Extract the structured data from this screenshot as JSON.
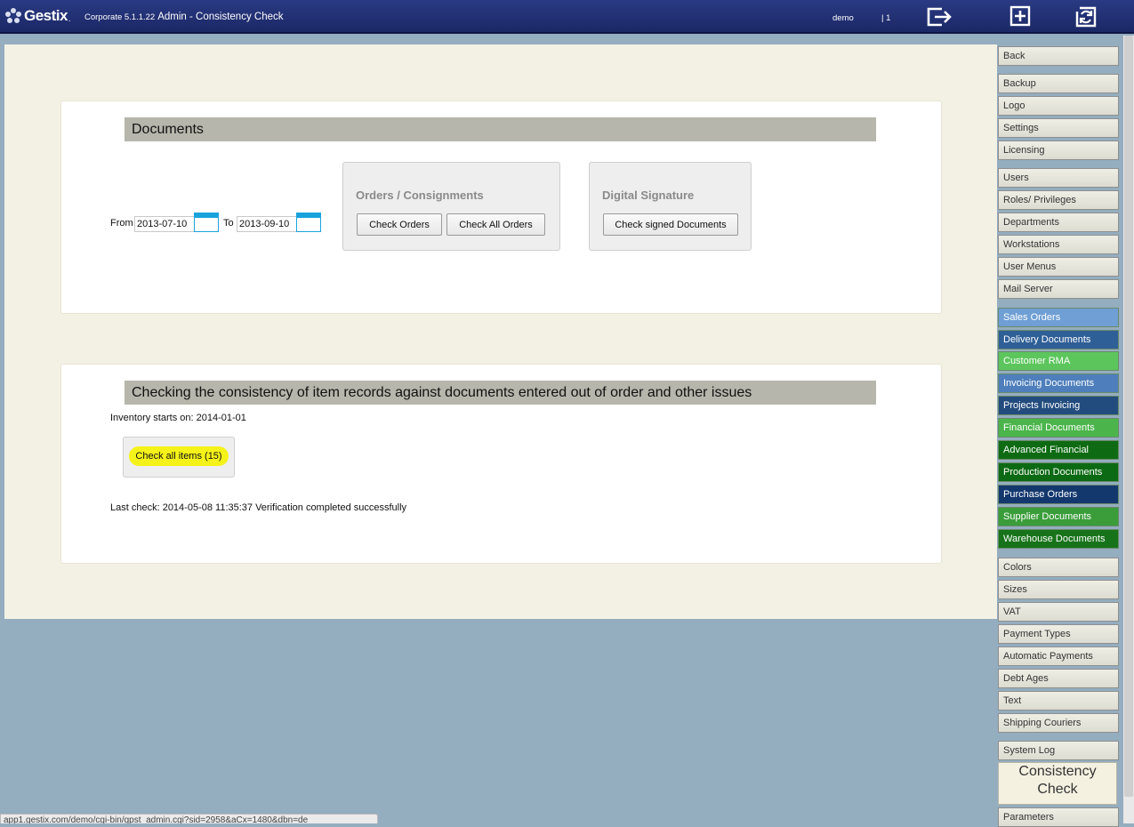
{
  "header": {
    "logo_text": "Gestix",
    "logo_dot": ".",
    "version": "Corporate 5.1.1.22",
    "title": "Admin - Consistency Check",
    "user": "demo",
    "user_count": "| 1",
    "icons": [
      "logout-icon",
      "add-window-icon",
      "refresh-window-icon"
    ]
  },
  "documents": {
    "heading": "Documents",
    "from_label": "From",
    "from_value": "2013-07-10",
    "to_label": "To",
    "to_value": "2013-09-10",
    "orders": {
      "title": "Orders / Consignments",
      "check_orders": "Check Orders",
      "check_all_orders": "Check All Orders"
    },
    "signature": {
      "title": "Digital Signature",
      "check_signed": "Check signed Documents"
    }
  },
  "items": {
    "heading": "Checking the consistency of item records against documents entered out of order and other issues",
    "inventory_start": "Inventory starts on: 2014-01-01",
    "check_all_items": "Check all items (15)",
    "last_check": "Last check: 2014-05-08 11:35:37 Verification completed successfully"
  },
  "nav": [
    {
      "label": "Back",
      "bg": ""
    },
    {
      "label": "Backup",
      "bg": ""
    },
    {
      "label": "Logo",
      "bg": ""
    },
    {
      "label": "Settings",
      "bg": ""
    },
    {
      "label": "Licensing",
      "bg": ""
    },
    {
      "label": "Users",
      "bg": ""
    },
    {
      "label": "Roles/ Privileges",
      "bg": ""
    },
    {
      "label": "Departments",
      "bg": ""
    },
    {
      "label": "Workstations",
      "bg": ""
    },
    {
      "label": "User Menus",
      "bg": ""
    },
    {
      "label": "Mail Server",
      "bg": ""
    },
    {
      "label": "Sales Orders",
      "bg": "#6f9fd4"
    },
    {
      "label": "Delivery Documents",
      "bg": "#2f5f97"
    },
    {
      "label": "Customer RMA",
      "bg": "#5cc65c"
    },
    {
      "label": "Invoicing Documents",
      "bg": "#4e7fbc"
    },
    {
      "label": "Projects Invoicing",
      "bg": "#234c7e"
    },
    {
      "label": "Financial Documents",
      "bg": "#4bb54b"
    },
    {
      "label": "Advanced Financial",
      "bg": "#0e6b13"
    },
    {
      "label": "Production Documents",
      "bg": "#0d6a14"
    },
    {
      "label": "Purchase Orders",
      "bg": "#13386e"
    },
    {
      "label": "Supplier Documents",
      "bg": "#3a9d3a"
    },
    {
      "label": "Warehouse Documents",
      "bg": "#17731a"
    },
    {
      "label": "Colors",
      "bg": ""
    },
    {
      "label": "Sizes",
      "bg": ""
    },
    {
      "label": "VAT",
      "bg": ""
    },
    {
      "label": "Payment Types",
      "bg": ""
    },
    {
      "label": "Automatic Payments",
      "bg": ""
    },
    {
      "label": "Debt Ages",
      "bg": ""
    },
    {
      "label": "Text",
      "bg": ""
    },
    {
      "label": "Shipping Couriers",
      "bg": ""
    },
    {
      "label": "System Log",
      "bg": ""
    },
    {
      "label": "Consistency Check",
      "bg": "",
      "active": true
    },
    {
      "label": "Parameters",
      "bg": ""
    }
  ],
  "status_url": "app1.gestix.com/demo/cgi-bin/gpst_admin.cgi?sid=2958&aCx=1480&dbn=de"
}
